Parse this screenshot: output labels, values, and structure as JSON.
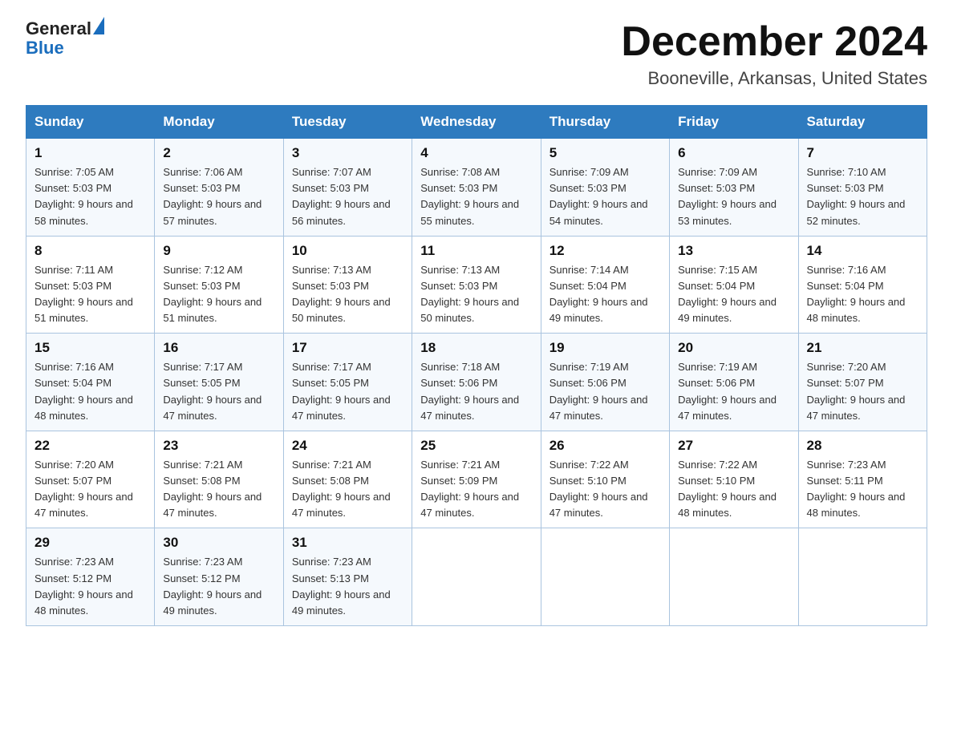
{
  "header": {
    "logo_line1": "General",
    "logo_line2": "Blue",
    "title": "December 2024",
    "subtitle": "Booneville, Arkansas, United States"
  },
  "weekdays": [
    "Sunday",
    "Monday",
    "Tuesday",
    "Wednesday",
    "Thursday",
    "Friday",
    "Saturday"
  ],
  "weeks": [
    [
      {
        "day": "1",
        "sunrise": "7:05 AM",
        "sunset": "5:03 PM",
        "daylight": "9 hours and 58 minutes."
      },
      {
        "day": "2",
        "sunrise": "7:06 AM",
        "sunset": "5:03 PM",
        "daylight": "9 hours and 57 minutes."
      },
      {
        "day": "3",
        "sunrise": "7:07 AM",
        "sunset": "5:03 PM",
        "daylight": "9 hours and 56 minutes."
      },
      {
        "day": "4",
        "sunrise": "7:08 AM",
        "sunset": "5:03 PM",
        "daylight": "9 hours and 55 minutes."
      },
      {
        "day": "5",
        "sunrise": "7:09 AM",
        "sunset": "5:03 PM",
        "daylight": "9 hours and 54 minutes."
      },
      {
        "day": "6",
        "sunrise": "7:09 AM",
        "sunset": "5:03 PM",
        "daylight": "9 hours and 53 minutes."
      },
      {
        "day": "7",
        "sunrise": "7:10 AM",
        "sunset": "5:03 PM",
        "daylight": "9 hours and 52 minutes."
      }
    ],
    [
      {
        "day": "8",
        "sunrise": "7:11 AM",
        "sunset": "5:03 PM",
        "daylight": "9 hours and 51 minutes."
      },
      {
        "day": "9",
        "sunrise": "7:12 AM",
        "sunset": "5:03 PM",
        "daylight": "9 hours and 51 minutes."
      },
      {
        "day": "10",
        "sunrise": "7:13 AM",
        "sunset": "5:03 PM",
        "daylight": "9 hours and 50 minutes."
      },
      {
        "day": "11",
        "sunrise": "7:13 AM",
        "sunset": "5:03 PM",
        "daylight": "9 hours and 50 minutes."
      },
      {
        "day": "12",
        "sunrise": "7:14 AM",
        "sunset": "5:04 PM",
        "daylight": "9 hours and 49 minutes."
      },
      {
        "day": "13",
        "sunrise": "7:15 AM",
        "sunset": "5:04 PM",
        "daylight": "9 hours and 49 minutes."
      },
      {
        "day": "14",
        "sunrise": "7:16 AM",
        "sunset": "5:04 PM",
        "daylight": "9 hours and 48 minutes."
      }
    ],
    [
      {
        "day": "15",
        "sunrise": "7:16 AM",
        "sunset": "5:04 PM",
        "daylight": "9 hours and 48 minutes."
      },
      {
        "day": "16",
        "sunrise": "7:17 AM",
        "sunset": "5:05 PM",
        "daylight": "9 hours and 47 minutes."
      },
      {
        "day": "17",
        "sunrise": "7:17 AM",
        "sunset": "5:05 PM",
        "daylight": "9 hours and 47 minutes."
      },
      {
        "day": "18",
        "sunrise": "7:18 AM",
        "sunset": "5:06 PM",
        "daylight": "9 hours and 47 minutes."
      },
      {
        "day": "19",
        "sunrise": "7:19 AM",
        "sunset": "5:06 PM",
        "daylight": "9 hours and 47 minutes."
      },
      {
        "day": "20",
        "sunrise": "7:19 AM",
        "sunset": "5:06 PM",
        "daylight": "9 hours and 47 minutes."
      },
      {
        "day": "21",
        "sunrise": "7:20 AM",
        "sunset": "5:07 PM",
        "daylight": "9 hours and 47 minutes."
      }
    ],
    [
      {
        "day": "22",
        "sunrise": "7:20 AM",
        "sunset": "5:07 PM",
        "daylight": "9 hours and 47 minutes."
      },
      {
        "day": "23",
        "sunrise": "7:21 AM",
        "sunset": "5:08 PM",
        "daylight": "9 hours and 47 minutes."
      },
      {
        "day": "24",
        "sunrise": "7:21 AM",
        "sunset": "5:08 PM",
        "daylight": "9 hours and 47 minutes."
      },
      {
        "day": "25",
        "sunrise": "7:21 AM",
        "sunset": "5:09 PM",
        "daylight": "9 hours and 47 minutes."
      },
      {
        "day": "26",
        "sunrise": "7:22 AM",
        "sunset": "5:10 PM",
        "daylight": "9 hours and 47 minutes."
      },
      {
        "day": "27",
        "sunrise": "7:22 AM",
        "sunset": "5:10 PM",
        "daylight": "9 hours and 48 minutes."
      },
      {
        "day": "28",
        "sunrise": "7:23 AM",
        "sunset": "5:11 PM",
        "daylight": "9 hours and 48 minutes."
      }
    ],
    [
      {
        "day": "29",
        "sunrise": "7:23 AM",
        "sunset": "5:12 PM",
        "daylight": "9 hours and 48 minutes."
      },
      {
        "day": "30",
        "sunrise": "7:23 AM",
        "sunset": "5:12 PM",
        "daylight": "9 hours and 49 minutes."
      },
      {
        "day": "31",
        "sunrise": "7:23 AM",
        "sunset": "5:13 PM",
        "daylight": "9 hours and 49 minutes."
      },
      null,
      null,
      null,
      null
    ]
  ]
}
